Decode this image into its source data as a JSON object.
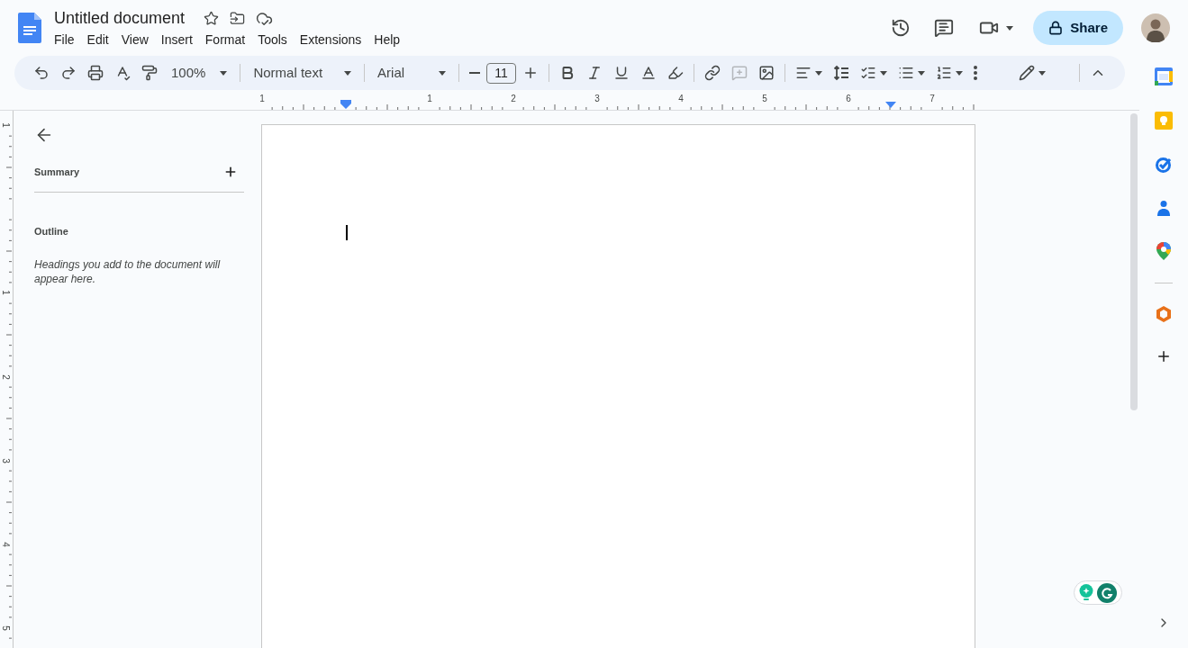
{
  "document": {
    "title": "Untitled document"
  },
  "menu": [
    "File",
    "Edit",
    "View",
    "Insert",
    "Format",
    "Tools",
    "Extensions",
    "Help"
  ],
  "share": {
    "label": "Share"
  },
  "toolbar": {
    "zoom": "100%",
    "style": "Normal text",
    "font": "Arial",
    "font_size": "11",
    "add_comment": {
      "disabled": true
    }
  },
  "ruler": {
    "horizontal": [
      "1",
      "1",
      "2",
      "3",
      "4",
      "5",
      "6",
      "7"
    ],
    "vertical": [
      "1",
      "1",
      "2",
      "3",
      "4",
      "5"
    ]
  },
  "outline_panel": {
    "summary": "Summary",
    "outline": "Outline",
    "hint": "Headings you add to the document will appear here."
  }
}
